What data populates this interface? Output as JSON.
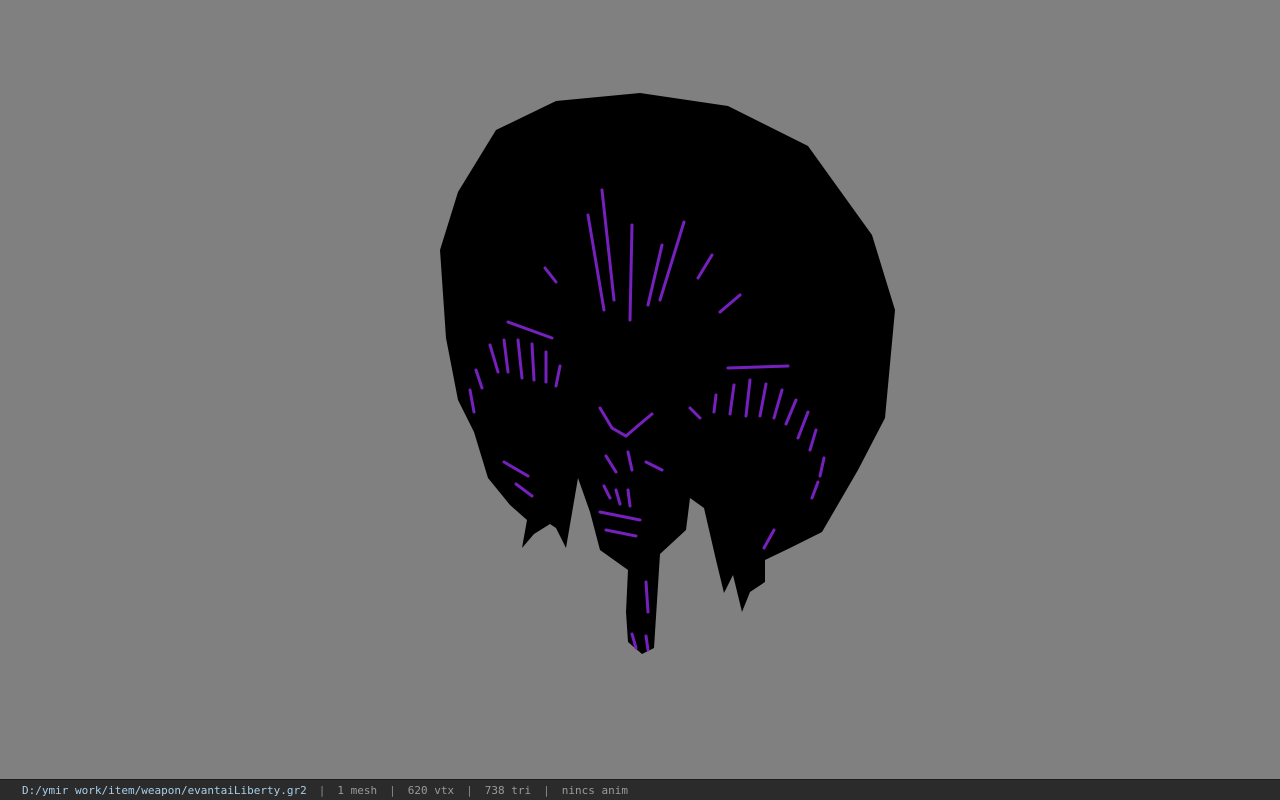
{
  "viewport": {
    "background": "#808080",
    "model_name": "evantaiLiberty"
  },
  "colors": {
    "model_body": "#000000",
    "glow": "#7d22c9",
    "status_bg": "#2b2b2b",
    "path_text": "#a8cde8"
  },
  "statusbar": {
    "path": "D:/ymir work/item/weapon/evantaiLiberty.gr2",
    "separator": "|",
    "mesh": "1 mesh",
    "vertices": "620 vtx",
    "triangles": "738 tri",
    "anim": "nincs anim"
  }
}
